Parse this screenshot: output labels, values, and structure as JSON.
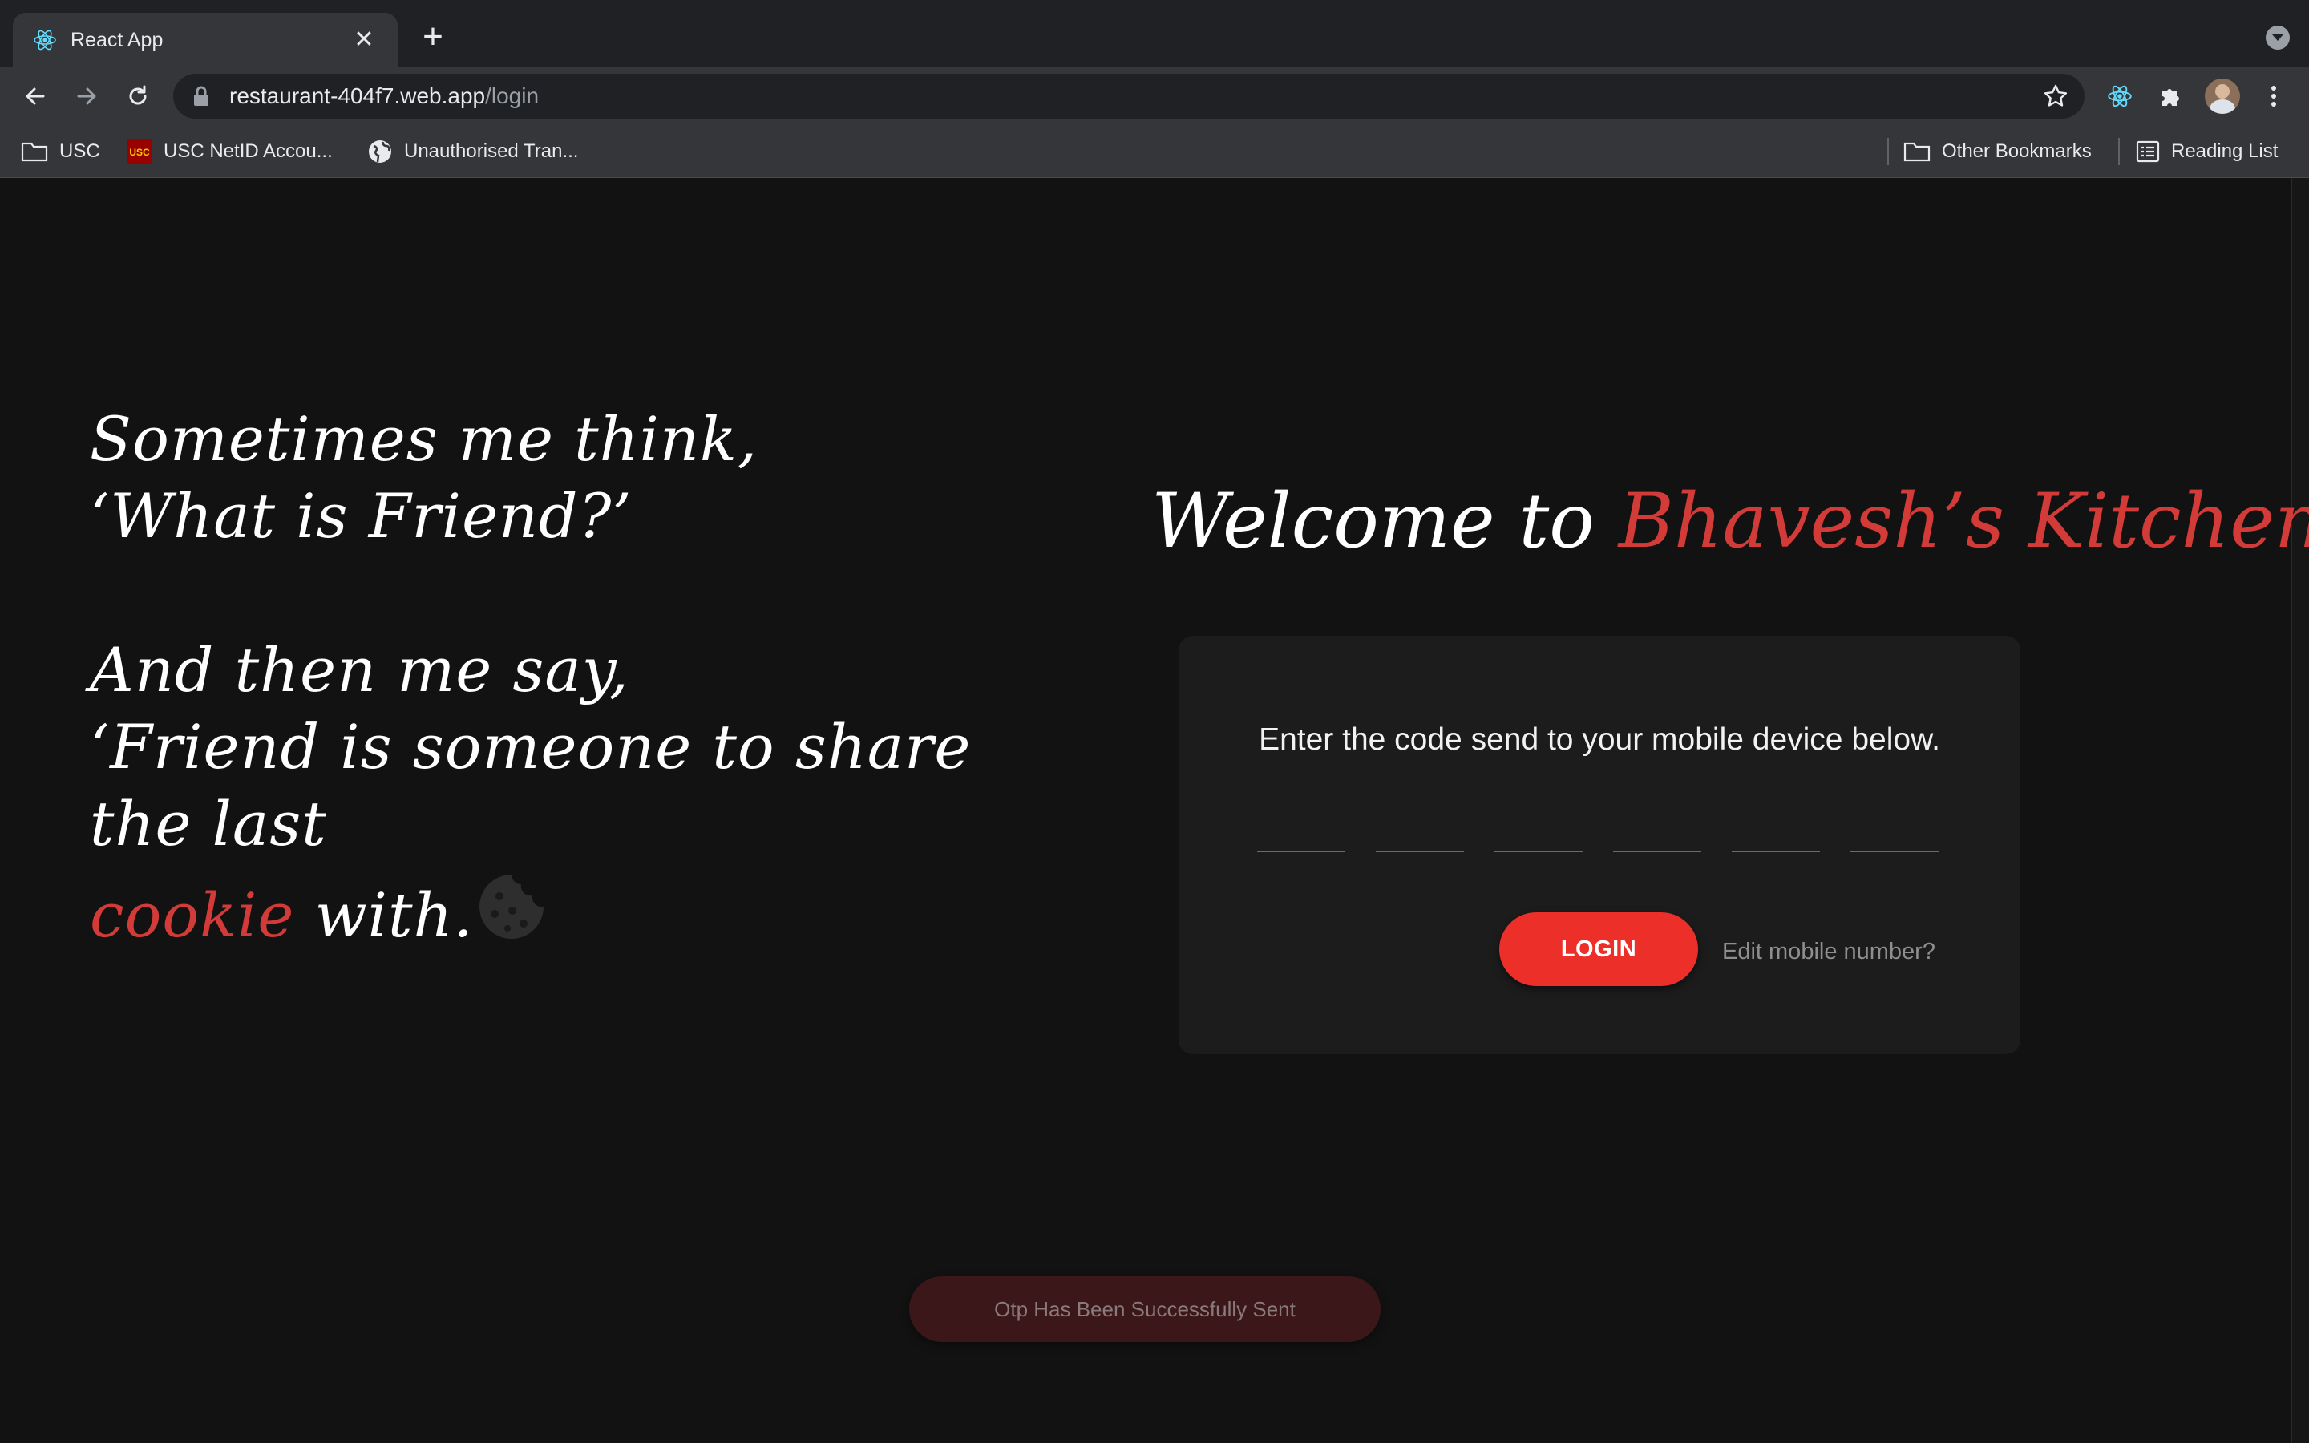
{
  "browser": {
    "tab_title": "React App",
    "url_host": "restaurant-404f7.web.app",
    "url_path": "/login",
    "bookmarks": [
      "USC",
      "USC NetID Accou...",
      "Unauthorised Tran..."
    ],
    "other_bookmarks": "Other Bookmarks",
    "reading_list": "Reading List"
  },
  "hero": {
    "line1": "Sometimes me think,",
    "line2": "‘What is Friend?’",
    "line3": "And then me say,",
    "line4": "‘Friend is someone to share the last",
    "highlight": "cookie",
    "line5_end": " with."
  },
  "welcome": {
    "prefix": "Welcome to ",
    "brand": "Bhavesh’s Kitchen"
  },
  "login_card": {
    "message": "Enter the code send to your mobile device below.",
    "otp_digits": [
      "",
      "",
      "",
      "",
      "",
      ""
    ],
    "login_label": "LOGIN",
    "edit_label": "Edit mobile number?"
  },
  "toast": {
    "message": "Otp Has Been Successfully Sent"
  },
  "colors": {
    "accent_red": "#d23b37",
    "button_red": "#ec2f28",
    "background": "#121212",
    "card": "#1c1c1c"
  },
  "icons": [
    "react-icon",
    "close-icon",
    "plus-icon",
    "back-icon",
    "forward-icon",
    "reload-icon",
    "lock-icon",
    "star-icon",
    "puzzle-icon",
    "folder-icon",
    "globe-icon",
    "reading-list-icon",
    "cookie-icon"
  ]
}
